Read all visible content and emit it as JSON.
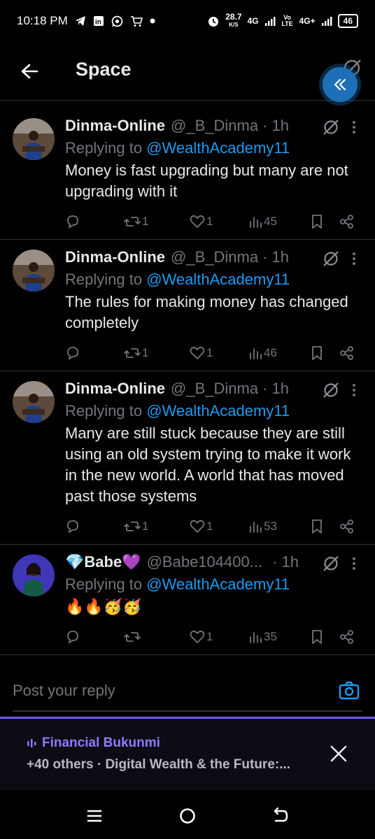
{
  "status_bar": {
    "time": "10:18 PM",
    "speed_value": "28.7",
    "speed_unit": "K/S",
    "network_1": "4G",
    "network_2": "Vo LTE",
    "network_3": "4G+",
    "battery": "46"
  },
  "header": {
    "title": "Space"
  },
  "posts": [
    {
      "name": "Dinma-Online",
      "handle": "@_B_Dinma",
      "time": "· 1h",
      "replying_prefix": "Replying to",
      "replying_to": "@WealthAcademy11",
      "text": "Money is fast upgrading but many are not upgrading with it",
      "reposts": "1",
      "likes": "1",
      "views": "45"
    },
    {
      "name": "Dinma-Online",
      "handle": "@_B_Dinma",
      "time": "· 1h",
      "replying_prefix": "Replying to",
      "replying_to": "@WealthAcademy11",
      "text": "The rules for making money has changed completely",
      "reposts": "1",
      "likes": "1",
      "views": "46"
    },
    {
      "name": "Dinma-Online",
      "handle": "@_B_Dinma",
      "time": "· 1h",
      "replying_prefix": "Replying to",
      "replying_to": "@WealthAcademy11",
      "text": "Many are still stuck because they are still using an old system trying to make it work in the new world. A world that has moved past those systems",
      "reposts": "1",
      "likes": "1",
      "views": "53"
    },
    {
      "name": "💎Babe💜",
      "handle": "@Babe104400...",
      "time": "· 1h",
      "replying_prefix": "Replying to",
      "replying_to": "@WealthAcademy11",
      "text": "🔥🔥🥳🥳",
      "reposts": "",
      "likes": "1",
      "views": "35"
    }
  ],
  "reply": {
    "placeholder": "Post your reply"
  },
  "space_bar": {
    "host": "Financial Bukunmi",
    "subtitle": "+40 others · Digital Wealth & the Future:..."
  },
  "colors": {
    "accent": "#1d9bf0",
    "space_purple": "#7856ff",
    "muted": "#71767b"
  }
}
